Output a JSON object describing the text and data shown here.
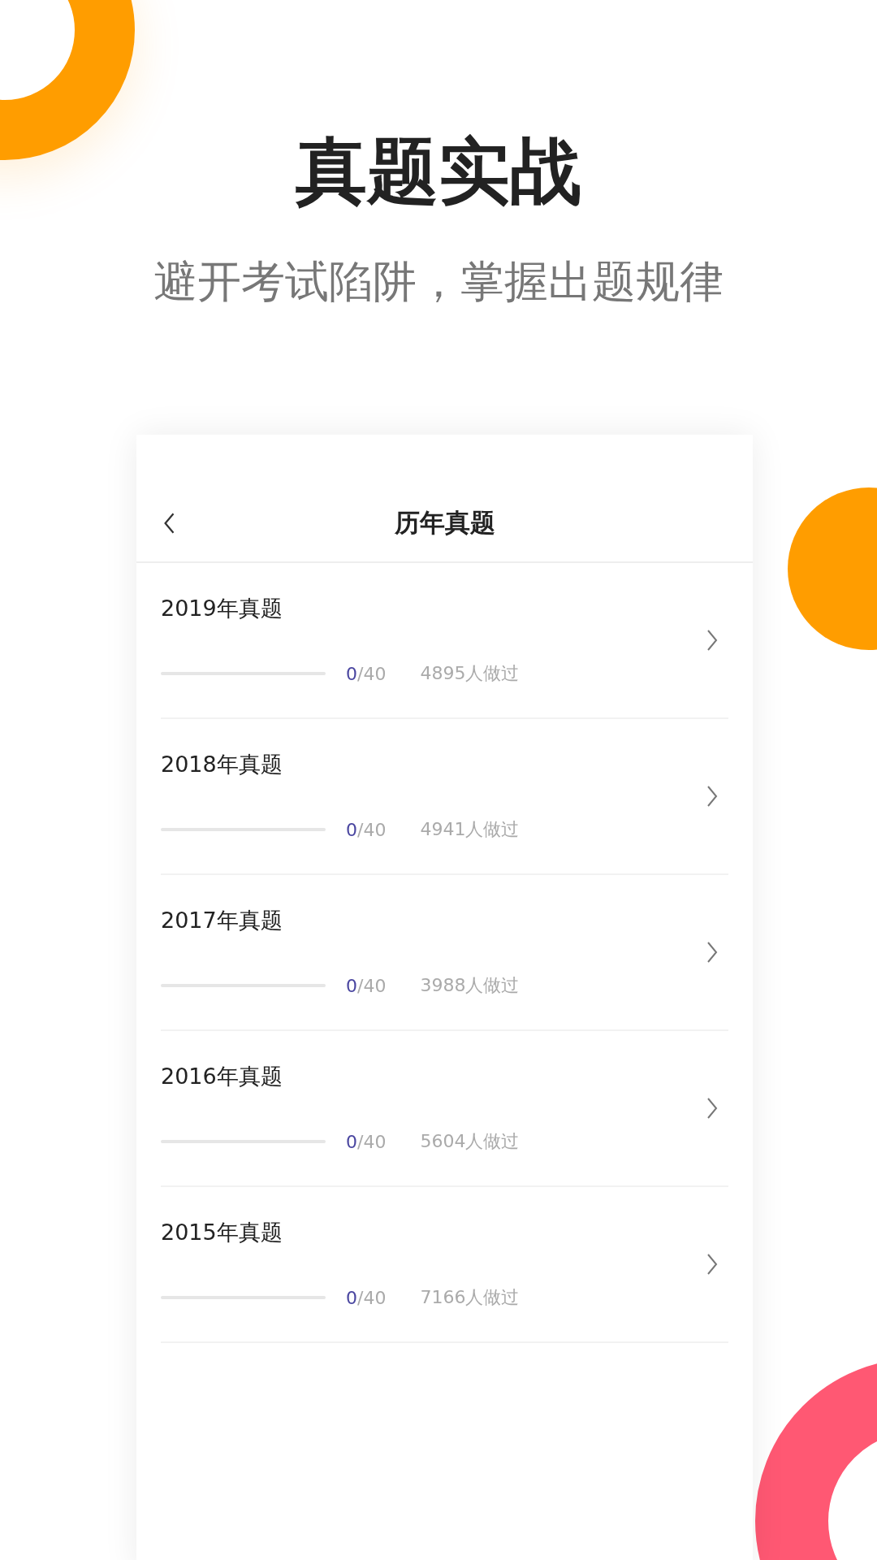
{
  "headline": "真题实战",
  "tagline": "避开考试陷阱，掌握出题规律",
  "screen": {
    "title": "历年真题",
    "rows": [
      {
        "title": "2019年真题",
        "level": 0,
        "done": "0",
        "total": "/40",
        "people": "4895人做过"
      },
      {
        "title": "2018年真题",
        "level": 0,
        "done": "0",
        "total": "/40",
        "people": "4941人做过"
      },
      {
        "title": "2017年真题",
        "level": 0,
        "done": "0",
        "total": "/40",
        "people": "3988人做过"
      },
      {
        "title": "2016年真题",
        "level": 0,
        "done": "0",
        "total": "/40",
        "people": "5604人做过"
      },
      {
        "title": "2015年真题",
        "level": 0,
        "done": "0",
        "total": "/40",
        "people": "7166人做过"
      }
    ]
  }
}
